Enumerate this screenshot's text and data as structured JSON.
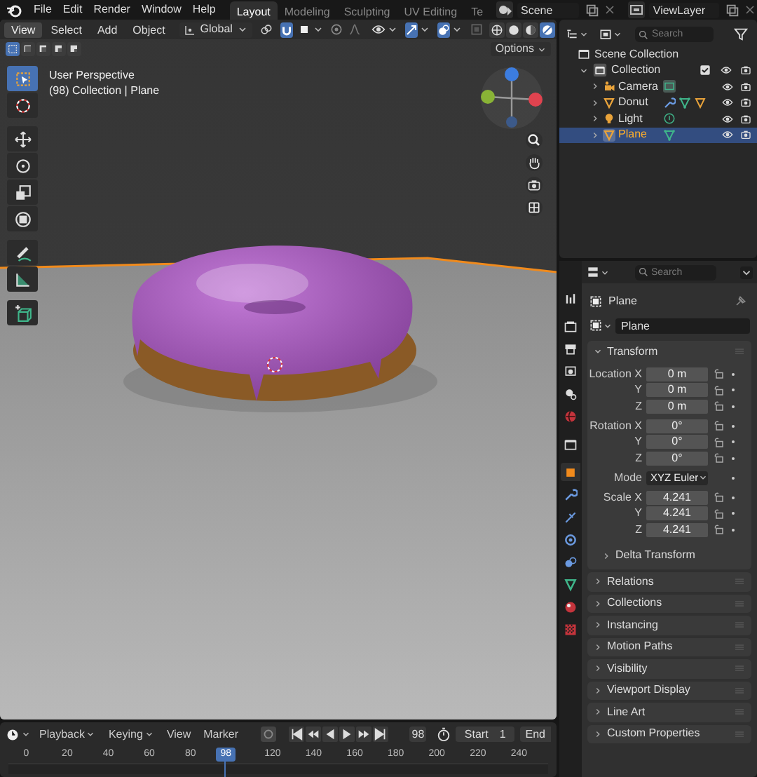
{
  "topbar": {
    "menus": [
      "File",
      "Edit",
      "Render",
      "Window",
      "Help"
    ],
    "workspaces": [
      {
        "label": "Layout",
        "selected": true
      },
      {
        "label": "Modeling",
        "selected": false
      },
      {
        "label": "Sculpting",
        "selected": false
      },
      {
        "label": "UV Editing",
        "selected": false
      },
      {
        "label": "Te",
        "selected": false
      }
    ],
    "scene": "Scene",
    "view_layer": "ViewLayer"
  },
  "viewport": {
    "menus": [
      {
        "label": "View",
        "selected": true
      },
      {
        "label": "Select",
        "selected": false
      },
      {
        "label": "Add",
        "selected": false
      },
      {
        "label": "Object",
        "selected": false
      }
    ],
    "orientation": "Global",
    "toggles": [
      {
        "kind": "snap",
        "on": true
      },
      {
        "kind": "gizmos",
        "on": true
      },
      {
        "kind": "overlays",
        "on": true
      }
    ],
    "shading_modes": [
      {
        "selected": false
      },
      {
        "selected": false
      },
      {
        "selected": false
      },
      {
        "selected": true
      }
    ],
    "select_modes": [
      {
        "selected": true
      },
      {
        "selected": false
      },
      {
        "selected": false
      },
      {
        "selected": false
      },
      {
        "selected": false
      }
    ],
    "options": "Options",
    "info": [
      "User Perspective",
      "(98) Collection | Plane"
    ],
    "tools": [
      {
        "selected": true
      },
      {
        "selected": false
      },
      {
        "selected": false
      },
      {
        "selected": false
      },
      {
        "selected": false
      },
      {
        "selected": false
      },
      {
        "selected": false
      },
      {
        "selected": false
      },
      {
        "selected": false
      }
    ]
  },
  "outliner": {
    "search_placeholder": "Search",
    "root": "Scene Collection",
    "tree": [
      {
        "name": "Collection",
        "expanded": true,
        "children": [
          {
            "name": "Camera",
            "kind": "camera",
            "selected": false
          },
          {
            "name": "Donut",
            "kind": "mesh",
            "selected": false
          },
          {
            "name": "Light",
            "kind": "light",
            "selected": false
          },
          {
            "name": "Plane",
            "kind": "mesh",
            "selected": true
          }
        ]
      }
    ]
  },
  "properties": {
    "search_placeholder": "Search",
    "tabs": [
      {
        "selected": false
      },
      {
        "selected": false
      },
      {
        "selected": false
      },
      {
        "selected": false
      },
      {
        "selected": false
      },
      {
        "selected": false
      },
      {
        "selected": false
      },
      {
        "selected": true
      },
      {
        "selected": false
      },
      {
        "selected": false
      },
      {
        "selected": false
      },
      {
        "selected": false
      },
      {
        "selected": false
      },
      {
        "selected": false
      },
      {
        "selected": false
      }
    ],
    "object_name": "Plane",
    "data_name": "Plane",
    "transform": {
      "title": "Transform",
      "expanded": true,
      "groups": [
        [
          {
            "kind": "field",
            "label": "Location X",
            "value": "0 m"
          },
          {
            "kind": "field",
            "label": "Y",
            "value": "0 m"
          },
          {
            "kind": "field",
            "label": "Z",
            "value": "0 m"
          }
        ],
        [
          {
            "kind": "field",
            "label": "Rotation X",
            "value": "0°"
          },
          {
            "kind": "field",
            "label": "Y",
            "value": "0°"
          },
          {
            "kind": "field",
            "label": "Z",
            "value": "0°"
          }
        ],
        [
          {
            "kind": "dropdown",
            "label": "Mode",
            "value": "XYZ Euler"
          }
        ],
        [
          {
            "kind": "field",
            "label": "Scale X",
            "value": "4.241"
          },
          {
            "kind": "field",
            "label": "Y",
            "value": "4.241"
          },
          {
            "kind": "field",
            "label": "Z",
            "value": "4.241"
          }
        ]
      ],
      "subpanel": "Delta Transform"
    },
    "panels": [
      "Relations",
      "Collections",
      "Instancing",
      "Motion Paths",
      "Visibility",
      "Viewport Display",
      "Line Art",
      "Custom Properties"
    ]
  },
  "timeline": {
    "menus": [
      "Playback",
      "Keying",
      "View",
      "Marker"
    ],
    "frame": "98",
    "start_label": "Start",
    "start": "1",
    "end_label": "End",
    "ruler": [
      {
        "kind": "tick",
        "label": "0"
      },
      {
        "kind": "tick",
        "label": "20"
      },
      {
        "kind": "tick",
        "label": "40"
      },
      {
        "kind": "tick",
        "label": "60"
      },
      {
        "kind": "tick",
        "label": "80"
      },
      {
        "kind": "playhead",
        "label": "98"
      },
      {
        "kind": "tick",
        "label": "120"
      },
      {
        "kind": "tick",
        "label": "140"
      },
      {
        "kind": "tick",
        "label": "160"
      },
      {
        "kind": "tick",
        "label": "180"
      },
      {
        "kind": "tick",
        "label": "200"
      },
      {
        "kind": "tick",
        "label": "220"
      },
      {
        "kind": "tick",
        "label": "240"
      }
    ]
  }
}
